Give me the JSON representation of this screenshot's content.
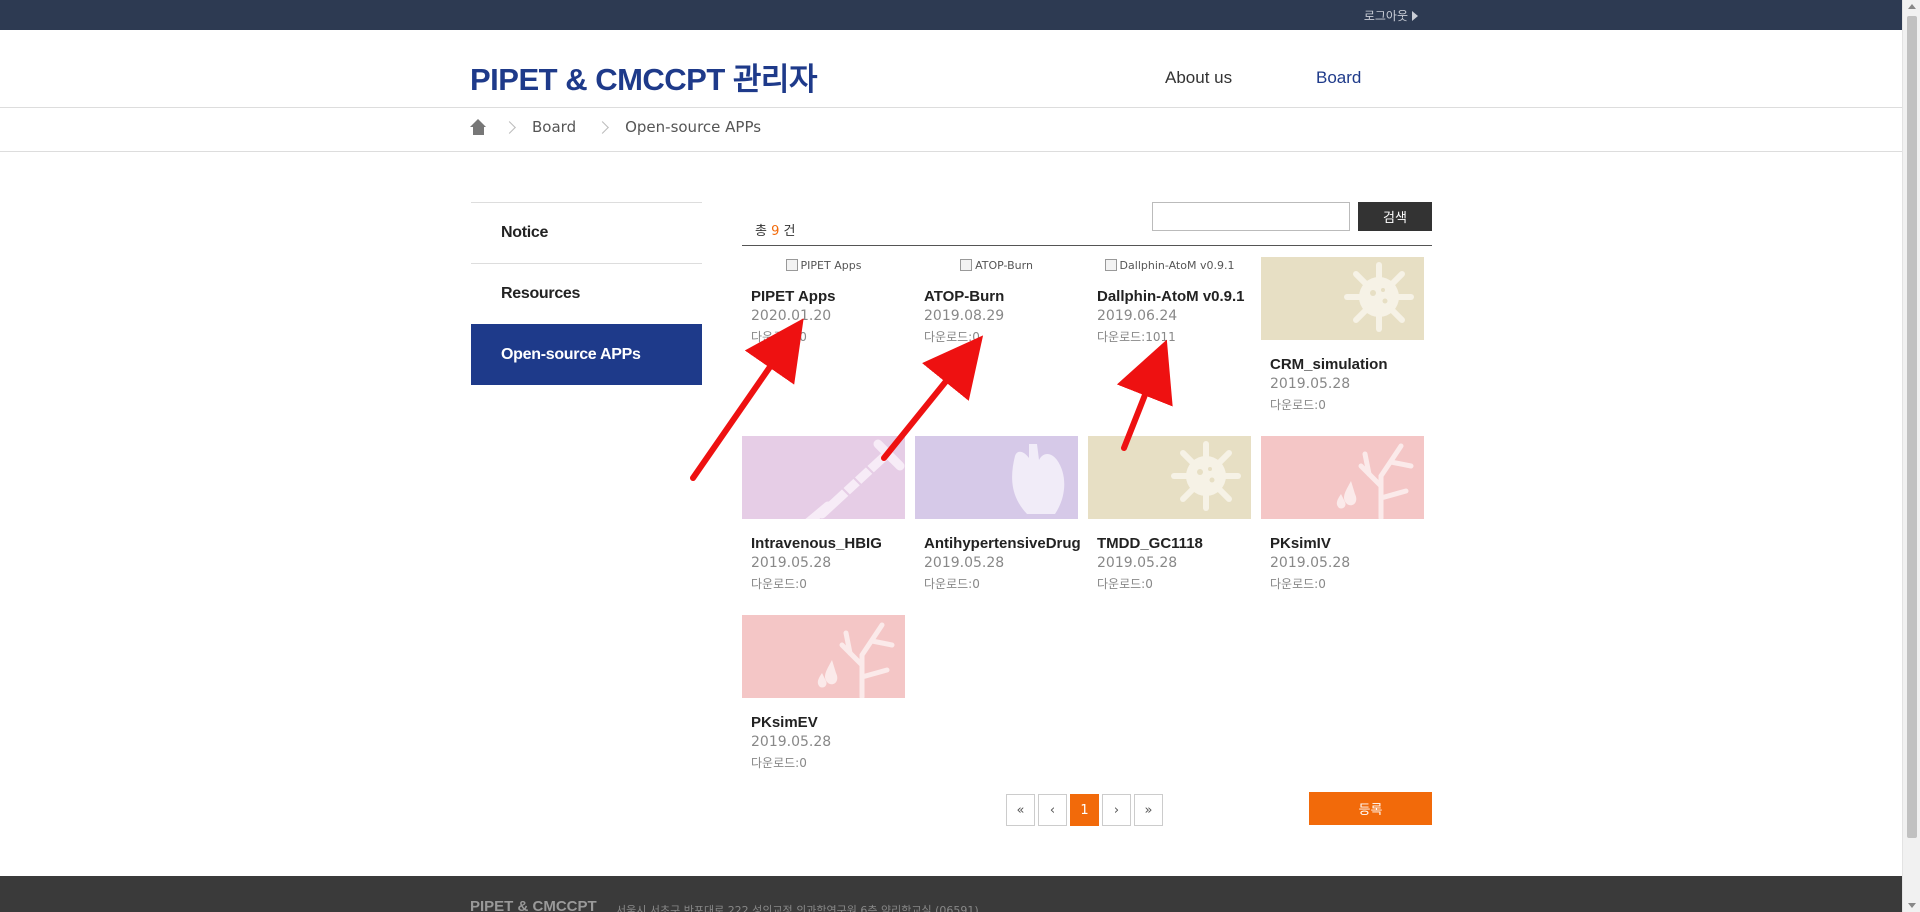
{
  "topbar": {
    "logout_label": "로그아웃"
  },
  "header": {
    "logo": "PIPET & CMCCPT 관리자",
    "nav": [
      {
        "label": "About us"
      },
      {
        "label": "Board"
      }
    ]
  },
  "breadcrumb": {
    "items": [
      "Board",
      "Open-source APPs"
    ]
  },
  "sidebar": {
    "items": [
      {
        "label": "Notice",
        "active": false
      },
      {
        "label": "Resources",
        "active": false
      },
      {
        "label": "Open-source APPs",
        "active": true
      }
    ]
  },
  "board": {
    "total_prefix": "총",
    "total_count": "9",
    "total_suffix": "건",
    "search_button": "검색",
    "search_value": "",
    "items": [
      {
        "title": "PIPET Apps",
        "date": "2020.01.20",
        "downloads": "다운로드:0",
        "thumb_alt": "PIPET Apps",
        "thumb": "broken"
      },
      {
        "title": "ATOP-Burn",
        "date": "2019.08.29",
        "downloads": "다운로드:0",
        "thumb_alt": "ATOP-Burn",
        "thumb": "broken"
      },
      {
        "title": "Dallphin-AtoM v0.9.1",
        "date": "2019.06.24",
        "downloads": "다운로드:1011",
        "thumb_alt": "Dallphin-AtoM v0.9.1",
        "thumb": "broken"
      },
      {
        "title": "CRM_simulation",
        "date": "2019.05.28",
        "downloads": "다운로드:0",
        "thumb": "virus-icon",
        "thumb_color": "#e7dfc4"
      },
      {
        "title": "Intravenous_HBIG",
        "date": "2019.05.28",
        "downloads": "다운로드:0",
        "thumb": "syringe-icon",
        "thumb_color": "#e6cde6"
      },
      {
        "title": "AntihypertensiveDrug",
        "date": "2019.05.28",
        "downloads": "다운로드:0",
        "thumb": "heart-icon",
        "thumb_color": "#d6c9e8"
      },
      {
        "title": "TMDD_GC1118",
        "date": "2019.05.28",
        "downloads": "다운로드:0",
        "thumb": "virus-icon",
        "thumb_color": "#e7dfc4"
      },
      {
        "title": "PKsimIV",
        "date": "2019.05.28",
        "downloads": "다운로드:0",
        "thumb": "lung-drop-icon",
        "thumb_color": "#f4c6c6"
      },
      {
        "title": "PKsimEV",
        "date": "2019.05.28",
        "downloads": "다운로드:0",
        "thumb": "lung-drop-icon",
        "thumb_color": "#f4c6c6"
      }
    ]
  },
  "pagination": {
    "first": "«",
    "prev": "‹",
    "current": "1",
    "next": "›",
    "last": "»"
  },
  "register_button": "등록",
  "footer": {
    "brand": "PIPET & CMCCPT",
    "address": "서울시 서초구 반포대로 222 성의교정 의과학연구원 6층 약리학교실 (06591)"
  },
  "colors": {
    "brand": "#1e3a8a",
    "accent": "#f26a0a",
    "topbar": "#2d3a52",
    "annotation_arrow": "#ee1111"
  }
}
